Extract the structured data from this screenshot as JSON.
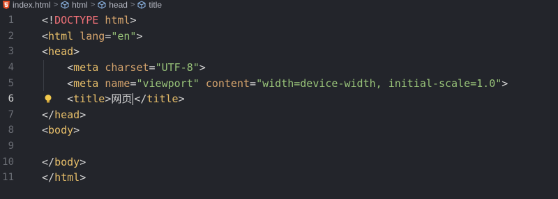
{
  "breadcrumb": {
    "file": "index.html",
    "items": [
      "html",
      "head",
      "title"
    ]
  },
  "icons": {
    "file": "html5-icon",
    "element": "cube-icon",
    "hint": "lightbulb-icon"
  },
  "colors": {
    "background": "#23252b",
    "tag": "#e8bf6a",
    "attribute": "#d5a46d",
    "string": "#98c379",
    "doctype_keyword": "#f07178",
    "line_number": "#6a6d74",
    "html5_orange": "#e44d26",
    "cube_blue": "#8fb8e8",
    "bulb_yellow": "#f2c94c"
  },
  "editor": {
    "active_line": 6,
    "lines": [
      {
        "num": "1",
        "tokens": [
          {
            "t": "<!",
            "c": "bracket"
          },
          {
            "t": "DOCTYPE",
            "c": "doctype-kw"
          },
          {
            "t": " ",
            "c": "plain"
          },
          {
            "t": "html",
            "c": "attr"
          },
          {
            "t": ">",
            "c": "bracket"
          }
        ]
      },
      {
        "num": "2",
        "tokens": [
          {
            "t": "<",
            "c": "bracket"
          },
          {
            "t": "html",
            "c": "tag"
          },
          {
            "t": " ",
            "c": "plain"
          },
          {
            "t": "lang",
            "c": "attr"
          },
          {
            "t": "=",
            "c": "plain"
          },
          {
            "t": "\"en\"",
            "c": "str"
          },
          {
            "t": ">",
            "c": "bracket"
          }
        ]
      },
      {
        "num": "3",
        "tokens": [
          {
            "t": "<",
            "c": "bracket"
          },
          {
            "t": "head",
            "c": "tag"
          },
          {
            "t": ">",
            "c": "bracket"
          }
        ]
      },
      {
        "num": "4",
        "tokens": [
          {
            "t": "    <",
            "c": "bracket"
          },
          {
            "t": "meta",
            "c": "tag"
          },
          {
            "t": " ",
            "c": "plain"
          },
          {
            "t": "charset",
            "c": "attr"
          },
          {
            "t": "=",
            "c": "plain"
          },
          {
            "t": "\"UTF-8\"",
            "c": "str"
          },
          {
            "t": ">",
            "c": "bracket"
          }
        ]
      },
      {
        "num": "5",
        "tokens": [
          {
            "t": "    <",
            "c": "bracket"
          },
          {
            "t": "meta",
            "c": "tag"
          },
          {
            "t": " ",
            "c": "plain"
          },
          {
            "t": "name",
            "c": "attr"
          },
          {
            "t": "=",
            "c": "plain"
          },
          {
            "t": "\"viewport\"",
            "c": "str"
          },
          {
            "t": " ",
            "c": "plain"
          },
          {
            "t": "content",
            "c": "attr"
          },
          {
            "t": "=",
            "c": "plain"
          },
          {
            "t": "\"width=device-width, initial-scale=1.0\"",
            "c": "str"
          },
          {
            "t": ">",
            "c": "bracket"
          }
        ]
      },
      {
        "num": "6",
        "tokens": [
          {
            "t": "    <",
            "c": "bracket"
          },
          {
            "t": "title",
            "c": "tag"
          },
          {
            "t": ">",
            "c": "bracket"
          },
          {
            "t": "网页",
            "c": "cjk"
          },
          {
            "t": "|cursor|",
            "c": "cursor"
          },
          {
            "t": "</",
            "c": "bracket"
          },
          {
            "t": "title",
            "c": "tag"
          },
          {
            "t": ">",
            "c": "bracket"
          }
        ]
      },
      {
        "num": "7",
        "tokens": [
          {
            "t": "</",
            "c": "bracket"
          },
          {
            "t": "head",
            "c": "tag"
          },
          {
            "t": ">",
            "c": "bracket"
          }
        ]
      },
      {
        "num": "8",
        "tokens": [
          {
            "t": "<",
            "c": "bracket"
          },
          {
            "t": "body",
            "c": "tag"
          },
          {
            "t": ">",
            "c": "bracket"
          }
        ]
      },
      {
        "num": "9",
        "tokens": []
      },
      {
        "num": "10",
        "tokens": [
          {
            "t": "</",
            "c": "bracket"
          },
          {
            "t": "body",
            "c": "tag"
          },
          {
            "t": ">",
            "c": "bracket"
          }
        ]
      },
      {
        "num": "11",
        "tokens": [
          {
            "t": "</",
            "c": "bracket"
          },
          {
            "t": "html",
            "c": "tag"
          },
          {
            "t": ">",
            "c": "bracket"
          }
        ]
      }
    ]
  }
}
